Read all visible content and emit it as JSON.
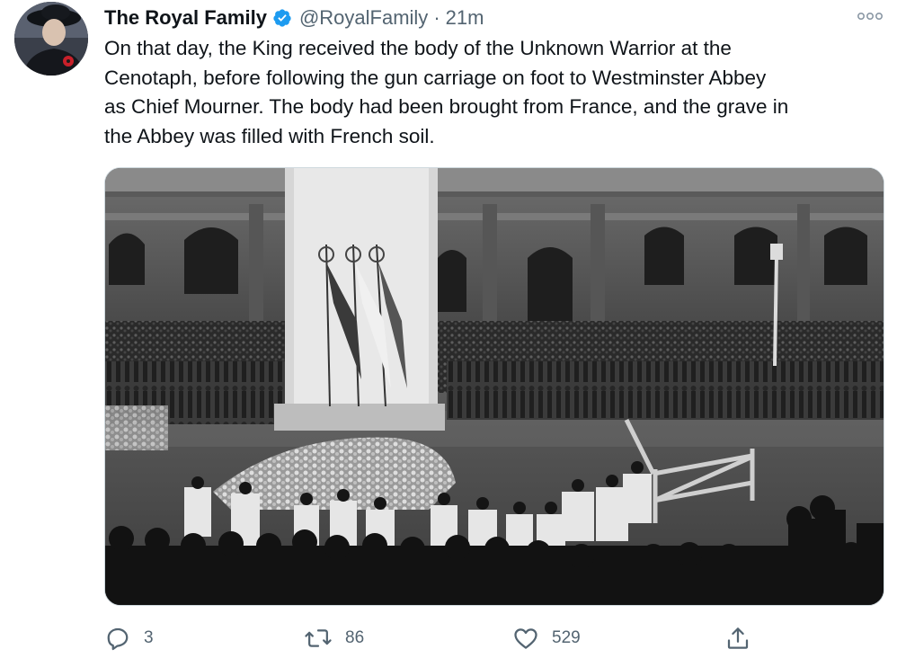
{
  "author": {
    "name": "The Royal Family",
    "handle": "@RoyalFamily",
    "separator": "·",
    "time": "21m",
    "verified": true,
    "avatar_icon": "avatar-queen-portrait"
  },
  "tweet": {
    "text": "On that day, the King received the body of the Unknown Warrior at the\nCenotaph, before following the gun carriage on foot to Westminster Abbey\nas Chief Mourner. The body had been brought from France, and the grave in\nthe Abbey was filled with French soil."
  },
  "media": {
    "kind": "photo",
    "tone": "black-and-white"
  },
  "actions": {
    "reply": {
      "icon": "reply-icon",
      "count": "3"
    },
    "retweet": {
      "icon": "retweet-icon",
      "count": "86"
    },
    "like": {
      "icon": "heart-icon",
      "count": "529"
    },
    "share": {
      "icon": "share-icon"
    }
  },
  "more_icon": "more-options-icon",
  "colors": {
    "text_primary": "#0f1419",
    "text_secondary": "#536471",
    "verified_blue": "#1d9bf0"
  }
}
